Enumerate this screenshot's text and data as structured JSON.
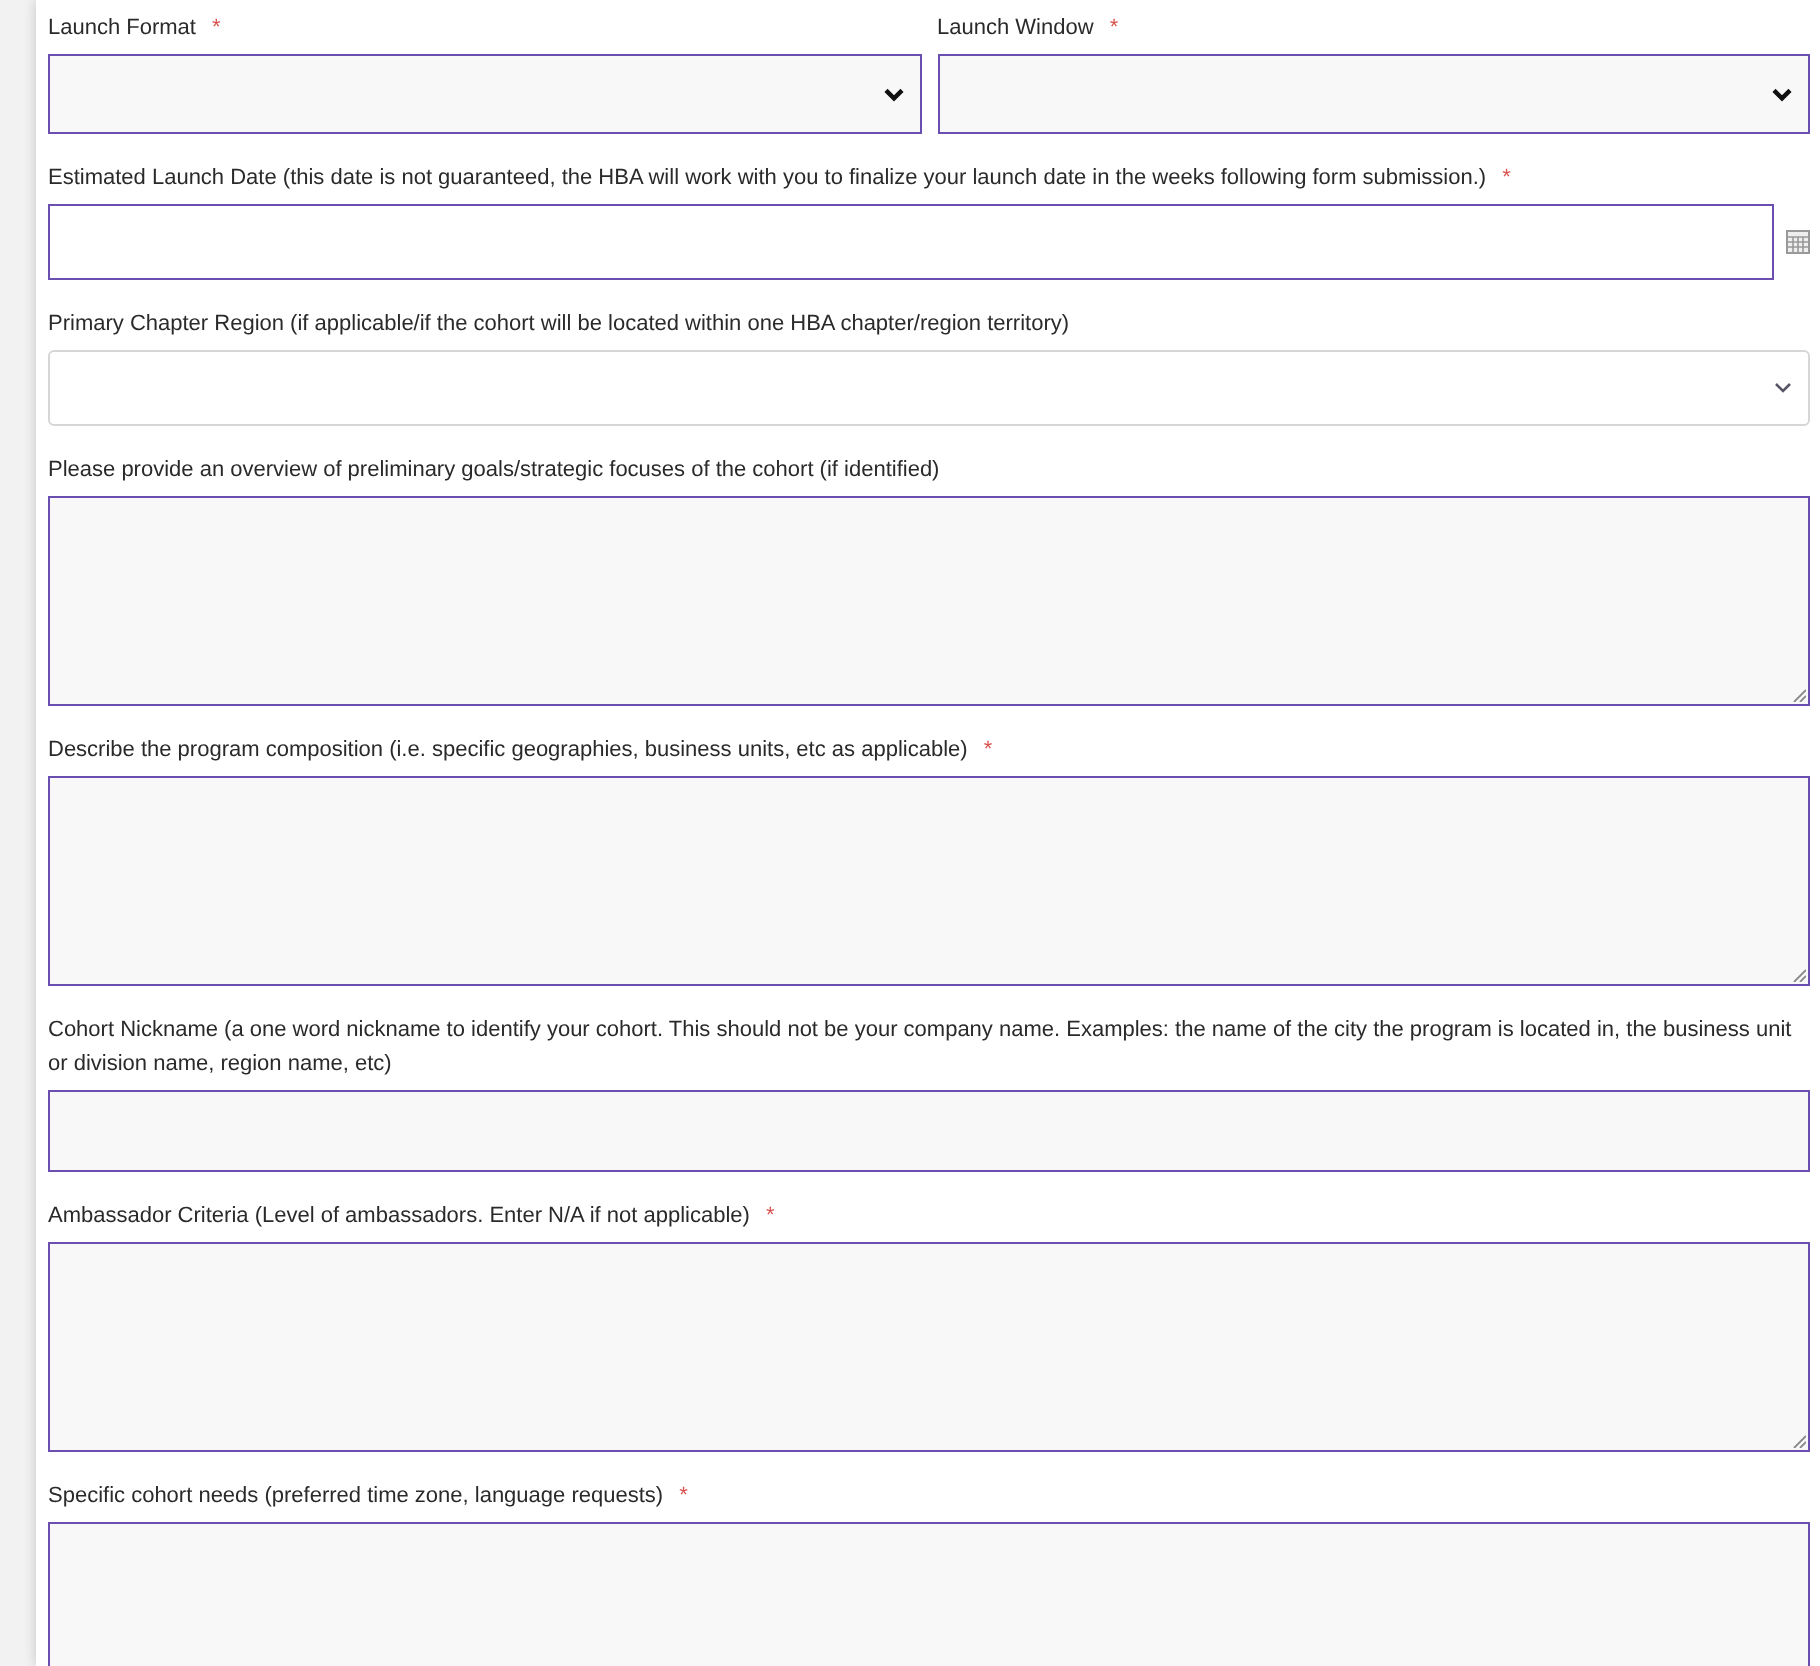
{
  "row": [
    {
      "kind": "select",
      "label": "Launch Format",
      "required_mark": "*"
    },
    {
      "kind": "select",
      "label": "Launch Window",
      "required_mark": "*"
    }
  ],
  "fields": [
    {
      "kind": "date",
      "label": "Estimated Launch Date (this date is not guaranteed, the HBA will work with you to finalize your launch date in the weeks following form submission.)",
      "required_mark": "*"
    },
    {
      "kind": "plain-select",
      "label": "Primary Chapter Region (if applicable/if the cohort will be located within one HBA chapter/region territory)"
    },
    {
      "kind": "textarea",
      "label": "Please provide an overview of preliminary goals/strategic focuses of the cohort (if identified)"
    },
    {
      "kind": "textarea",
      "label": "Describe the program composition (i.e. specific geographies, business units, etc as applicable)",
      "required_mark": "*"
    },
    {
      "kind": "input",
      "label": "Cohort Nickname (a one word nickname to identify your cohort. This should not be your company name. Examples: the name of the city the program is located in, the business unit or division name, region name, etc)"
    },
    {
      "kind": "textarea",
      "label": "Ambassador Criteria (Level of ambassadors. Enter N/A if not applicable)",
      "required_mark": "*"
    },
    {
      "kind": "textarea",
      "label": "Specific cohort needs (preferred time zone, language requests)",
      "required_mark": "*"
    }
  ]
}
